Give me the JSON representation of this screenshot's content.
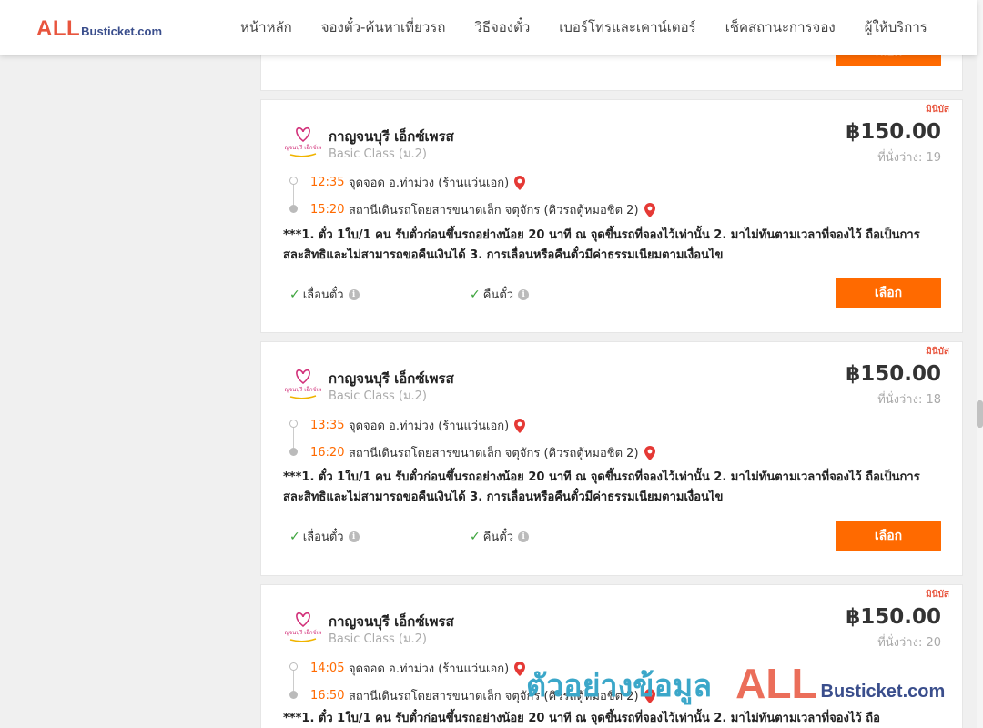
{
  "brand": {
    "all": "ALL",
    "rest": "Busticket.com"
  },
  "nav": [
    {
      "label": "หน้าหลัก"
    },
    {
      "label": "จองตั๋ว-ค้นหาเที่ยวรถ"
    },
    {
      "label": "วิธีจองตั๋ว"
    },
    {
      "label": "เบอร์โทรและเคาน์เตอร์"
    },
    {
      "label": "เช็คสถานะการจอง"
    },
    {
      "label": "ผู้ให้บริการ"
    }
  ],
  "select_label": "เลือก",
  "trips": [
    {
      "ribbon": "มินิบัส",
      "operator": "กาญจนบุรี เอ็กซ์เพรส",
      "class": "Basic Class (ม.2)",
      "price": "฿150.00",
      "seats": "ที่นั่งว่าง: 19",
      "depart_time": "12:35",
      "depart_place": "จุดจอด อ.ท่าม่วง (ร้านแว่นเอก)",
      "arrive_time": "15:20",
      "arrive_place": "สถานีเดินรถโดยสารขนาดเล็ก จตุจักร (คิวรถตู้หมอชิต 2)",
      "note": "***1. ตั๋ว 1ใบ/1 คน รับตั๋วก่อนขึ้นรถอย่างน้อย 20 นาที ณ จุดขึ้นรถที่จองไว้เท่านั้น 2. มาไม่ทันตามเวลาที่จองไว้ ถือเป็นการสละสิทธิและไม่สามารถขอคืนเงินได้ 3. การเลื่อนหรือคืนตั๋วมีค่าธรรมเนียมตามเงื่อนไข",
      "feature_change": "เลื่อนตั๋ว",
      "feature_refund": "คืนตั๋ว"
    },
    {
      "ribbon": "มินิบัส",
      "operator": "กาญจนบุรี เอ็กซ์เพรส",
      "class": "Basic Class (ม.2)",
      "price": "฿150.00",
      "seats": "ที่นั่งว่าง: 18",
      "depart_time": "13:35",
      "depart_place": "จุดจอด อ.ท่าม่วง (ร้านแว่นเอก)",
      "arrive_time": "16:20",
      "arrive_place": "สถานีเดินรถโดยสารขนาดเล็ก จตุจักร (คิวรถตู้หมอชิต 2)",
      "note": "***1. ตั๋ว 1ใบ/1 คน รับตั๋วก่อนขึ้นรถอย่างน้อย 20 นาที ณ จุดขึ้นรถที่จองไว้เท่านั้น 2. มาไม่ทันตามเวลาที่จองไว้ ถือเป็นการสละสิทธิและไม่สามารถขอคืนเงินได้ 3. การเลื่อนหรือคืนตั๋วมีค่าธรรมเนียมตามเงื่อนไข",
      "feature_change": "เลื่อนตั๋ว",
      "feature_refund": "คืนตั๋ว"
    },
    {
      "ribbon": "มินิบัส",
      "operator": "กาญจนบุรี เอ็กซ์เพรส",
      "class": "Basic Class (ม.2)",
      "price": "฿150.00",
      "seats": "ที่นั่งว่าง: 20",
      "depart_time": "14:05",
      "depart_place": "จุดจอด อ.ท่าม่วง (ร้านแว่นเอก)",
      "arrive_time": "16:50",
      "arrive_place": "สถานีเดินรถโดยสารขนาดเล็ก จตุจักร (คิวรถตู้หมอชิต 2)",
      "note": "***1. ตั๋ว 1ใบ/1 คน รับตั๋วก่อนขึ้นรถอย่างน้อย 20 นาที ณ จุดขึ้นรถที่จองไว้เท่านั้น 2. มาไม่ทันตามเวลาที่จองไว้ ถือ",
      "feature_change": "",
      "feature_refund": ""
    }
  ],
  "operator_logo_text": "กาญจนบุรี เอ็กซ์เพรส",
  "watermark": {
    "thai": "ตัวอย่างข้อมูล",
    "all": "ALL",
    "rest": "Busticket.com"
  }
}
